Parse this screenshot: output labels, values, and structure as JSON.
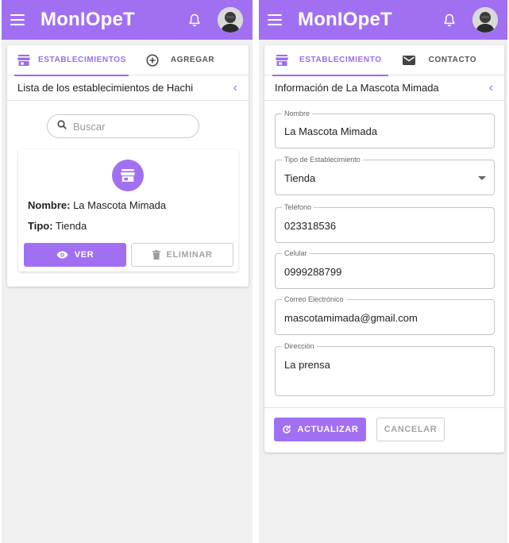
{
  "app": {
    "title": "MonIOpeT"
  },
  "left": {
    "tabs": [
      {
        "label": "ESTABLECIMIENTOS"
      },
      {
        "label": "AGREGAR"
      }
    ],
    "section_title": "Lista de los establecimientos de Hachi",
    "search": {
      "placeholder": "Buscar"
    },
    "establishment": {
      "name_label": "Nombre:",
      "name_value": "La Mascota Mimada",
      "type_label": "Tipo:",
      "type_value": "Tienda",
      "view_button": "VER",
      "delete_button": "ELIMINAR"
    }
  },
  "right": {
    "tabs": [
      {
        "label": "ESTABLECIMIENTO"
      },
      {
        "label": "CONTACTO"
      }
    ],
    "section_title": "Información de La Mascota Mimada",
    "fields": {
      "nombre": {
        "label": "Nombre",
        "value": "La Mascota Mimada"
      },
      "tipo": {
        "label": "Tipo de Establecimiento",
        "value": "Tienda"
      },
      "telefono": {
        "label": "Teléfono",
        "value": "023318536"
      },
      "celular": {
        "label": "Celular",
        "value": "0999288799"
      },
      "correo": {
        "label": "Correo Electrónico",
        "value": "mascotamimada@gmail.com"
      },
      "direccion": {
        "label": "Dirección",
        "value": "La prensa"
      }
    },
    "update_button": "ACTUALIZAR",
    "cancel_button": "CANCELAR"
  },
  "colors": {
    "accent": "#a170f2",
    "divider": "#e2e2e2",
    "background": "#f0f0f0"
  },
  "icons": [
    "menu-icon",
    "bell-icon",
    "store-icon",
    "add-circle-icon",
    "search-icon",
    "eye-icon",
    "trash-icon",
    "mail-icon",
    "chevron-left-icon",
    "refresh-icon",
    "dropdown-caret-icon"
  ]
}
